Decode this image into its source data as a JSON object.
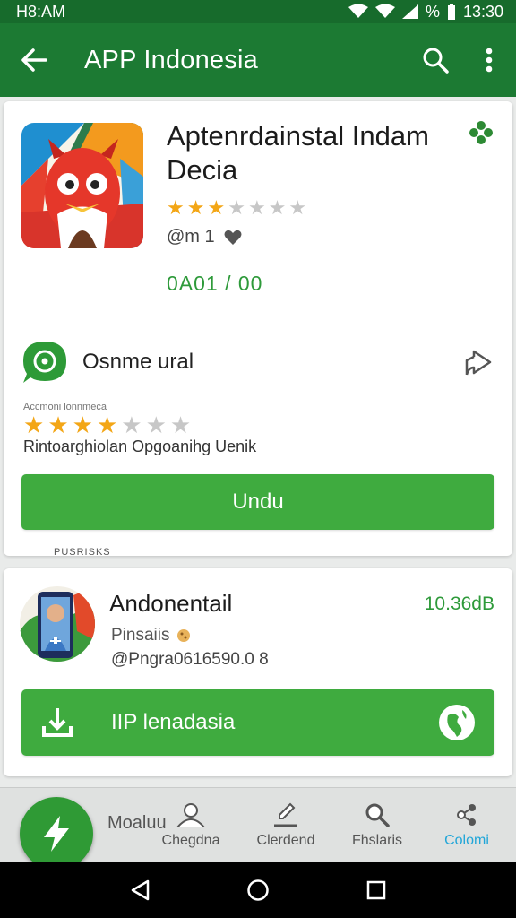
{
  "status_bar": {
    "time_left": "H8:AM",
    "battery": "%",
    "time_right": "13:30"
  },
  "app_bar": {
    "title": "APP Indonesia"
  },
  "featured": {
    "title": "Aptenrdainstal Indam Decia",
    "rating": 2.5,
    "stars_total": 7,
    "meta": "@m 1",
    "price": "0A01 / 00",
    "developer": "Osnme ural",
    "review_caption": "Accmoni lonnmeca",
    "review_stars": 4,
    "review_stars_total": 7,
    "review_text": "Rintoarghiolan  Opgoanihg Uenik",
    "download_label": "Undu"
  },
  "separator_label": "PUSRISKS",
  "second_app": {
    "title": "Andonentail",
    "size": "10.36dB",
    "subtitle": "Pinsaiis",
    "meta": "@Pngra0616590.0  8",
    "install_label": "IIP lenadasia"
  },
  "bottom_nav": {
    "fab_label": "Moaluu",
    "items": [
      {
        "label": "Chegdna",
        "icon": "person-icon",
        "active": false
      },
      {
        "label": "Clerdend",
        "icon": "pen-icon",
        "active": false
      },
      {
        "label": "Fhslaris",
        "icon": "search-icon",
        "active": false
      },
      {
        "label": "Colomi",
        "icon": "share-nodes-icon",
        "active": true
      }
    ]
  },
  "colors": {
    "primary": "#1c7a33",
    "button": "#3fab3f",
    "price": "#2e9a3a",
    "active_nav": "#21a6d8",
    "star": "#f3a616"
  }
}
